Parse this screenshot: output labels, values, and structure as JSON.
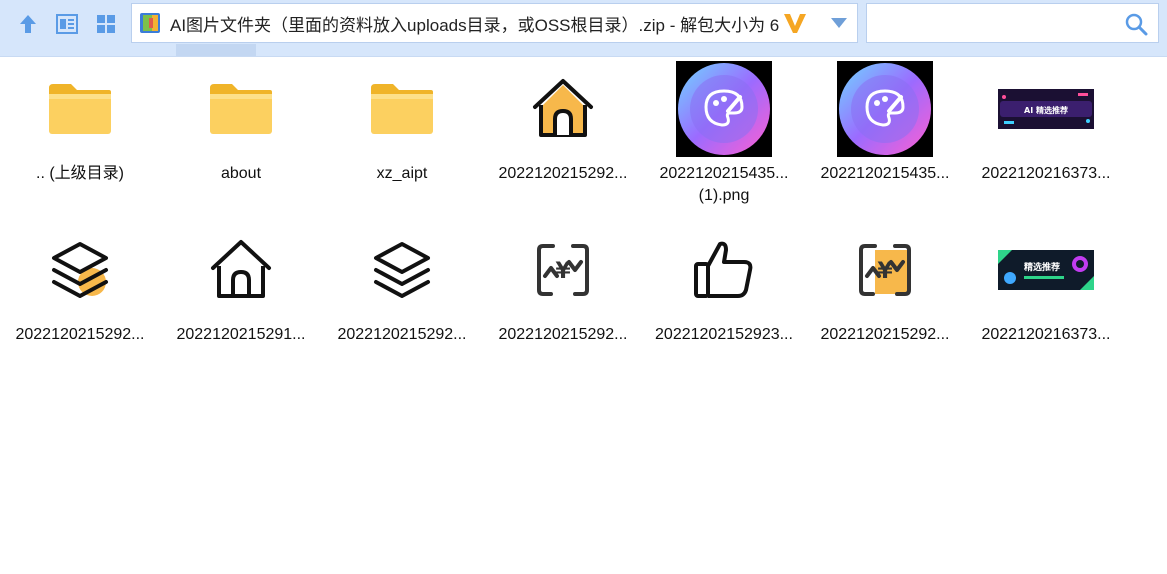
{
  "toolbar": {
    "path_text": "AI图片文件夹（里面的资料放入uploads目录，或OSS根目录）.zip - 解包大小为 6",
    "search_placeholder": "",
    "search_value": ""
  },
  "colors": {
    "toolbar_bg": "#d6e6fb",
    "accent_blue": "#4a8ee0",
    "folder_yellow": "#f7c948",
    "icon_orange": "#f7b84b"
  },
  "files": [
    {
      "label1": ".. (上级目录)",
      "label2": "",
      "icon": "folder-icon"
    },
    {
      "label1": "about",
      "label2": "",
      "icon": "folder-icon"
    },
    {
      "label1": "xz_aipt",
      "label2": "",
      "icon": "folder-icon"
    },
    {
      "label1": "2022120215292...",
      "label2": "",
      "icon": "home-orange-icon"
    },
    {
      "label1": "2022120215435...",
      "label2": "(1).png",
      "icon": "palette-app-icon"
    },
    {
      "label1": "2022120215435...",
      "label2": "",
      "icon": "palette-app-icon"
    },
    {
      "label1": "2022120216373...",
      "label2": "",
      "icon": "ai-banner-image"
    },
    {
      "label1": "2022120215292...",
      "label2": "",
      "icon": "layers-orange-icon"
    },
    {
      "label1": "2022120215291...",
      "label2": "",
      "icon": "home-outline-icon"
    },
    {
      "label1": "2022120215292...",
      "label2": "",
      "icon": "layers-outline-icon"
    },
    {
      "label1": "2022120215292...",
      "label2": "",
      "icon": "yuan-outline-icon"
    },
    {
      "label1": "20221202152923...",
      "label2": "",
      "icon": "thumbs-up-icon"
    },
    {
      "label1": "2022120215292...",
      "label2": "",
      "icon": "yuan-orange-icon"
    },
    {
      "label1": "2022120216373...",
      "label2": "",
      "icon": "recommend-banner-image"
    }
  ],
  "banners": {
    "ai_banner_text": "AI 精选推荐",
    "recommend_banner_text": "精选推荐"
  }
}
